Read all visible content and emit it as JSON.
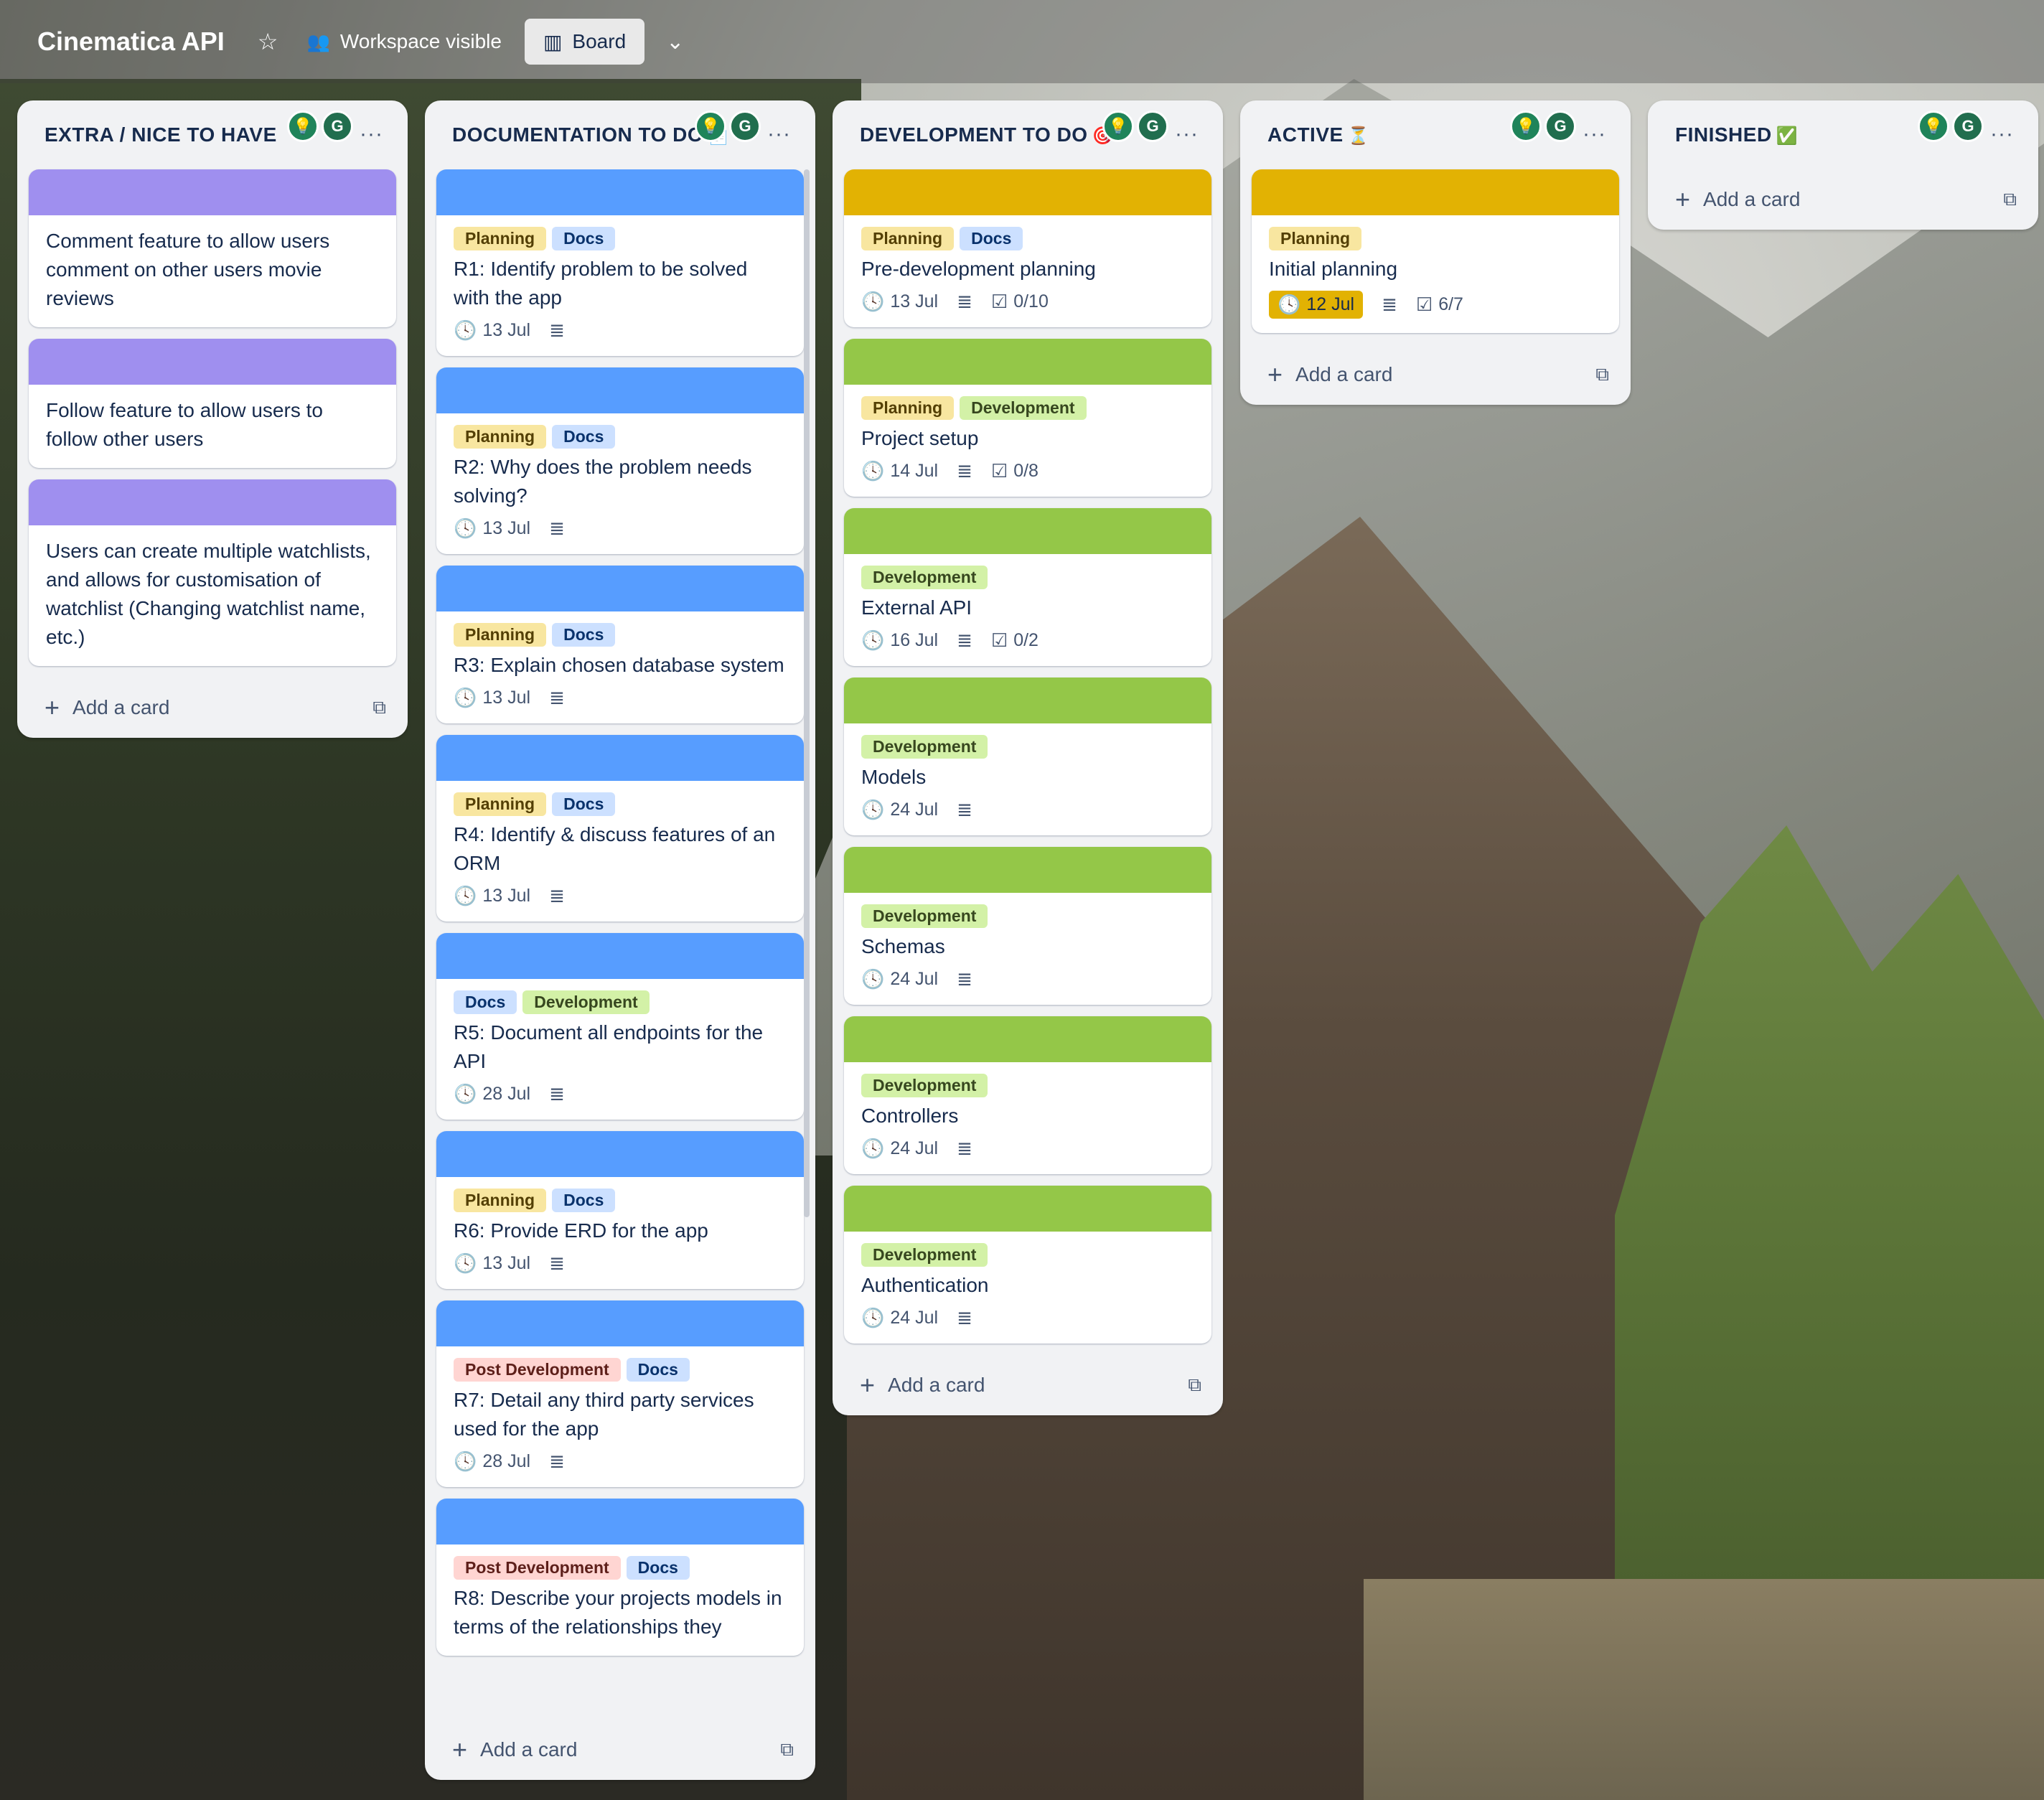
{
  "header": {
    "title": "Cinematica API",
    "visibility": "Workspace visible",
    "view": "Board",
    "star_icon": "star-icon",
    "chevron_icon": "chevron-down-icon"
  },
  "lists": [
    {
      "title": "EXTRA / NICE TO HAVE",
      "emoji": "",
      "add_label": "Add a card",
      "cards": [
        {
          "cover": "#9f8fef",
          "title": "Comment feature to allow users comment on other users movie reviews"
        },
        {
          "cover": "#9f8fef",
          "title": "Follow feature to allow users to follow other users"
        },
        {
          "cover": "#9f8fef",
          "title": "Users can create multiple watchlists, and allows for customisation of watchlist (Changing watchlist name, etc.)"
        }
      ]
    },
    {
      "title": "DOCUMENTATION TO DO",
      "emoji": "📄 •",
      "add_label": "Add a card",
      "cards": [
        {
          "cover": "#579dff",
          "labels": [
            "Planning",
            "Docs"
          ],
          "title": "R1: Identify problem to be solved with the app",
          "due": "13 Jul"
        },
        {
          "cover": "#579dff",
          "labels": [
            "Planning",
            "Docs"
          ],
          "title": "R2: Why does the problem needs solving?",
          "due": "13 Jul"
        },
        {
          "cover": "#579dff",
          "labels": [
            "Planning",
            "Docs"
          ],
          "title": "R3: Explain chosen database system",
          "due": "13 Jul"
        },
        {
          "cover": "#579dff",
          "labels": [
            "Planning",
            "Docs"
          ],
          "title": "R4: Identify & discuss features of an ORM",
          "due": "13 Jul"
        },
        {
          "cover": "#579dff",
          "labels": [
            "Docs",
            "Development"
          ],
          "title": "R5: Document all endpoints for the API",
          "due": "28 Jul"
        },
        {
          "cover": "#579dff",
          "labels": [
            "Planning",
            "Docs"
          ],
          "title": "R6: Provide ERD for the app",
          "due": "13 Jul"
        },
        {
          "cover": "#579dff",
          "labels": [
            "Post Development",
            "Docs"
          ],
          "title": "R7: Detail any third party services used for the app",
          "due": "28 Jul"
        },
        {
          "cover": "#579dff",
          "labels": [
            "Post Development",
            "Docs"
          ],
          "title": "R8: Describe your projects models in terms of the relationships they",
          "due": ""
        }
      ]
    },
    {
      "title": "DEVELOPMENT TO DO",
      "emoji": "🎯",
      "add_label": "Add a card",
      "cards": [
        {
          "cover": "#e2b203",
          "labels": [
            "Planning",
            "Docs"
          ],
          "title": "Pre-development planning",
          "due": "13 Jul",
          "checklist": "0/10"
        },
        {
          "cover": "#94c748",
          "labels": [
            "Planning",
            "Development"
          ],
          "title": "Project setup",
          "due": "14 Jul",
          "checklist": "0/8"
        },
        {
          "cover": "#94c748",
          "labels": [
            "Development"
          ],
          "title": "External API",
          "due": "16 Jul",
          "checklist": "0/2"
        },
        {
          "cover": "#94c748",
          "labels": [
            "Development"
          ],
          "title": "Models",
          "due": "24 Jul"
        },
        {
          "cover": "#94c748",
          "labels": [
            "Development"
          ],
          "title": "Schemas",
          "due": "24 Jul"
        },
        {
          "cover": "#94c748",
          "labels": [
            "Development"
          ],
          "title": "Controllers",
          "due": "24 Jul"
        },
        {
          "cover": "#94c748",
          "labels": [
            "Development"
          ],
          "title": "Authentication",
          "due": "24 Jul"
        }
      ]
    },
    {
      "title": "ACTIVE",
      "emoji": "⏳",
      "add_label": "Add a card",
      "cards": [
        {
          "cover": "#e2b203",
          "labels": [
            "Planning"
          ],
          "title": "Initial planning",
          "due": "12 Jul",
          "due_highlight": true,
          "checklist": "6/7"
        }
      ]
    },
    {
      "title": "FINISHED",
      "emoji": "✅",
      "add_label": "Add a card",
      "cards": []
    }
  ],
  "colors": {
    "planning": "#f8e6a0",
    "docs": "#cce0ff",
    "development": "#d3f1a7",
    "post_development": "#ffd5d2",
    "due_highlight": "#e2b203"
  }
}
